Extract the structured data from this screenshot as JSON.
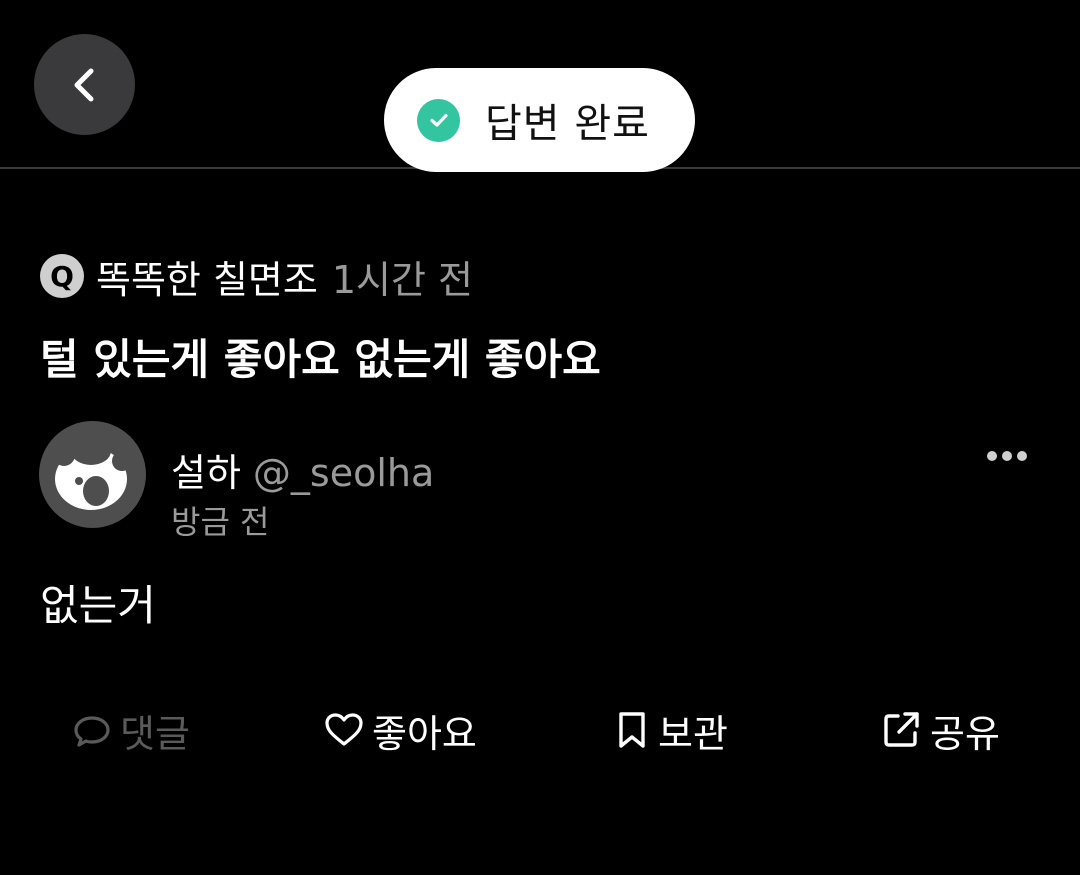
{
  "header": {
    "back_icon": "chevron-left-icon"
  },
  "toast": {
    "icon": "check-circle-icon",
    "text": "답변 완료",
    "accent_color": "#33c5a0"
  },
  "question": {
    "badge": "Q",
    "author": "똑똑한 칠면조",
    "time": "1시간 전",
    "text": "털 있는게 좋아요 없는게 좋아요"
  },
  "answer": {
    "avatar_icon": "panda-avatar-icon",
    "name": "설하",
    "handle": "@_seolha",
    "time": "방금 전",
    "text": "없는거",
    "more_icon": "more-horizontal-icon"
  },
  "actions": [
    {
      "icon": "comment-icon",
      "label": "댓글",
      "enabled": false
    },
    {
      "icon": "heart-icon",
      "label": "좋아요",
      "enabled": true
    },
    {
      "icon": "bookmark-icon",
      "label": "보관",
      "enabled": true
    },
    {
      "icon": "share-icon",
      "label": "공유",
      "enabled": true
    }
  ]
}
